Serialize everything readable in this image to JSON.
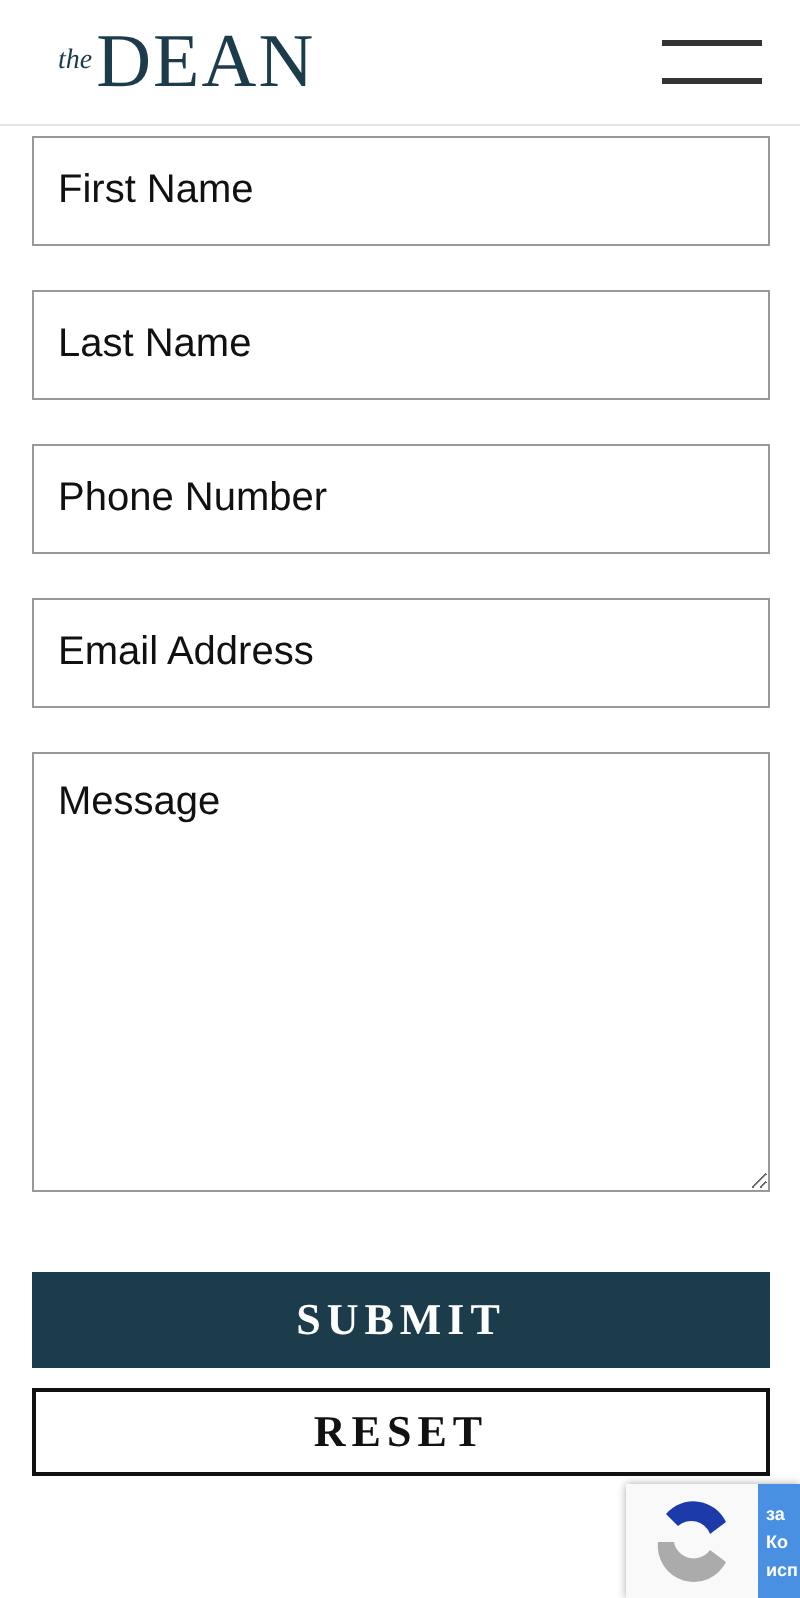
{
  "header": {
    "logo_prefix": "the",
    "logo_name": "DEAN"
  },
  "form": {
    "fields": [
      {
        "kind": "input",
        "placeholder": "First Name"
      },
      {
        "kind": "input",
        "placeholder": "Last Name"
      },
      {
        "kind": "input",
        "placeholder": "Phone Number"
      },
      {
        "kind": "input",
        "placeholder": "Email Address"
      },
      {
        "kind": "textarea",
        "placeholder": "Message"
      }
    ],
    "buttons": [
      {
        "kind": "primary",
        "label": "SUBMIT"
      },
      {
        "kind": "outline",
        "label": "RESET"
      }
    ]
  },
  "recaptcha": {
    "lines": [
      "за",
      "Ко",
      "исп"
    ]
  }
}
